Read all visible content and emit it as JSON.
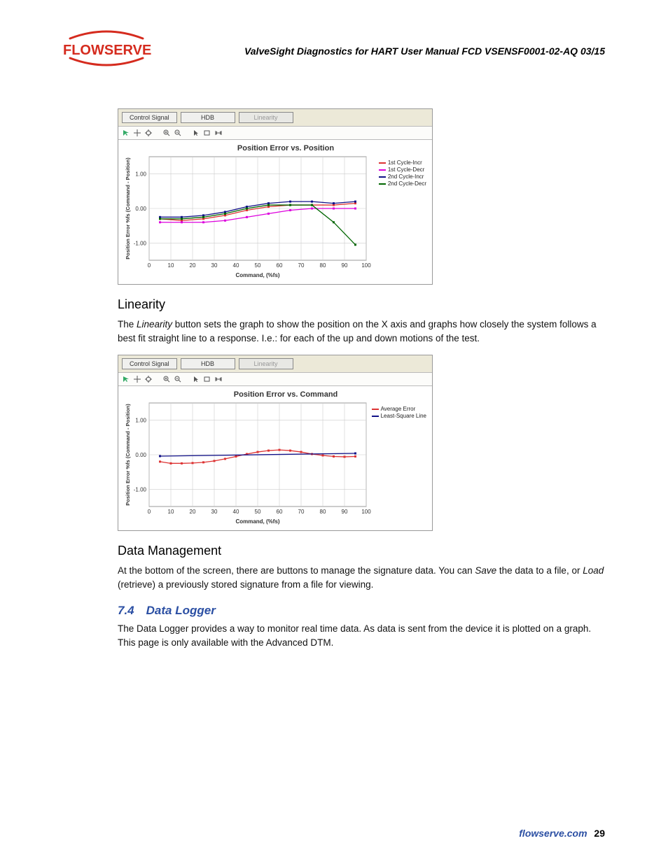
{
  "brand": {
    "name": "FLOWSERVE"
  },
  "header": {
    "title": "ValveSight Diagnostics for HART User Manual FCD VSENSF0001-02-AQ 03/15"
  },
  "sections": {
    "linearity_h": "Linearity",
    "linearity_p": "The Linearity button sets the graph to show the position on the X axis and graphs how closely the system follows a best fit straight line to a response. I.e.: for each of the up and down motions of the test.",
    "linearity_word": "Linearity",
    "datamgmt_h": "Data Management",
    "datamgmt_p": "At the bottom of the screen, there are buttons to manage the signature data. You can Save the data to a file, or Load (retrieve) a previously stored signature from a file for viewing.",
    "save_word": "Save",
    "load_word": "Load",
    "logger_h": "7.4 Data Logger",
    "logger_p": "The Data Logger provides a way to monitor real time data. As data is sent from the device it is plotted on a graph. This page is only available with the Advanced DTM."
  },
  "chart1": {
    "tabs": [
      "Control Signal",
      "HDB",
      "Linearity"
    ],
    "active_tab": 2,
    "title": "Position Error vs. Position",
    "ylabel": "Position Error %fs (Command - Position)",
    "xlabel": "Command, (%fs)",
    "legend": [
      "1st Cycle-Incr",
      "1st Cycle-Decr",
      "2nd Cycle-Incr",
      "2nd Cycle-Decr"
    ]
  },
  "chart2": {
    "tabs": [
      "Control Signal",
      "HDB",
      "Linearity"
    ],
    "active_tab": 2,
    "title": "Position Error vs. Command",
    "ylabel": "Position Error %fs (Command - Position)",
    "xlabel": "Command, (%fs)",
    "legend": [
      "Average Error",
      "Least-Square Line"
    ]
  },
  "chart_data": [
    {
      "type": "line",
      "title": "Position Error vs. Position",
      "xlabel": "Command, (%fs)",
      "ylabel": "Position Error %fs (Command - Position)",
      "xlim": [
        0,
        100
      ],
      "ylim": [
        -1.5,
        1.5
      ],
      "xticks": [
        0,
        10,
        20,
        30,
        40,
        50,
        60,
        70,
        80,
        90,
        100
      ],
      "yticks": [
        -1.0,
        0.0,
        1.0
      ],
      "series": [
        {
          "name": "1st Cycle-Incr",
          "color": "#d33",
          "values": [
            [
              5,
              -0.3
            ],
            [
              15,
              -0.35
            ],
            [
              25,
              -0.3
            ],
            [
              35,
              -0.2
            ],
            [
              45,
              -0.05
            ],
            [
              55,
              0.05
            ],
            [
              65,
              0.1
            ],
            [
              75,
              0.1
            ],
            [
              85,
              0.1
            ],
            [
              95,
              0.15
            ]
          ]
        },
        {
          "name": "1st Cycle-Decr",
          "color": "#d0d",
          "values": [
            [
              5,
              -0.4
            ],
            [
              15,
              -0.4
            ],
            [
              25,
              -0.4
            ],
            [
              35,
              -0.35
            ],
            [
              45,
              -0.25
            ],
            [
              55,
              -0.15
            ],
            [
              65,
              -0.05
            ],
            [
              75,
              0.0
            ],
            [
              85,
              0.0
            ],
            [
              95,
              0.0
            ]
          ]
        },
        {
          "name": "2nd Cycle-Incr",
          "color": "#118",
          "values": [
            [
              5,
              -0.25
            ],
            [
              15,
              -0.25
            ],
            [
              25,
              -0.2
            ],
            [
              35,
              -0.1
            ],
            [
              45,
              0.05
            ],
            [
              55,
              0.15
            ],
            [
              65,
              0.2
            ],
            [
              75,
              0.2
            ],
            [
              85,
              0.15
            ],
            [
              95,
              0.2
            ]
          ]
        },
        {
          "name": "2nd Cycle-Decr",
          "color": "#060",
          "values": [
            [
              5,
              -0.3
            ],
            [
              15,
              -0.3
            ],
            [
              25,
              -0.25
            ],
            [
              35,
              -0.15
            ],
            [
              45,
              0.0
            ],
            [
              55,
              0.1
            ],
            [
              65,
              0.1
            ],
            [
              75,
              0.1
            ],
            [
              85,
              -0.4
            ],
            [
              95,
              -1.05
            ]
          ]
        }
      ]
    },
    {
      "type": "line",
      "title": "Position Error vs. Command",
      "xlabel": "Command, (%fs)",
      "ylabel": "Position Error %fs (Command - Position)",
      "xlim": [
        0,
        100
      ],
      "ylim": [
        -1.5,
        1.5
      ],
      "xticks": [
        0,
        10,
        20,
        30,
        40,
        50,
        60,
        70,
        80,
        90,
        100
      ],
      "yticks": [
        -1.0,
        0.0,
        1.0
      ],
      "series": [
        {
          "name": "Average Error",
          "color": "#d33",
          "values": [
            [
              5,
              -0.2
            ],
            [
              10,
              -0.25
            ],
            [
              15,
              -0.25
            ],
            [
              20,
              -0.24
            ],
            [
              25,
              -0.22
            ],
            [
              30,
              -0.18
            ],
            [
              35,
              -0.12
            ],
            [
              40,
              -0.05
            ],
            [
              45,
              0.02
            ],
            [
              50,
              0.08
            ],
            [
              55,
              0.12
            ],
            [
              60,
              0.14
            ],
            [
              65,
              0.12
            ],
            [
              70,
              0.08
            ],
            [
              75,
              0.02
            ],
            [
              80,
              -0.02
            ],
            [
              85,
              -0.05
            ],
            [
              90,
              -0.06
            ],
            [
              95,
              -0.05
            ]
          ]
        },
        {
          "name": "Least-Square Line",
          "color": "#118",
          "values": [
            [
              5,
              -0.04
            ],
            [
              95,
              0.04
            ]
          ]
        }
      ]
    }
  ],
  "footer": {
    "site": "flowserve.com",
    "page": "29"
  }
}
